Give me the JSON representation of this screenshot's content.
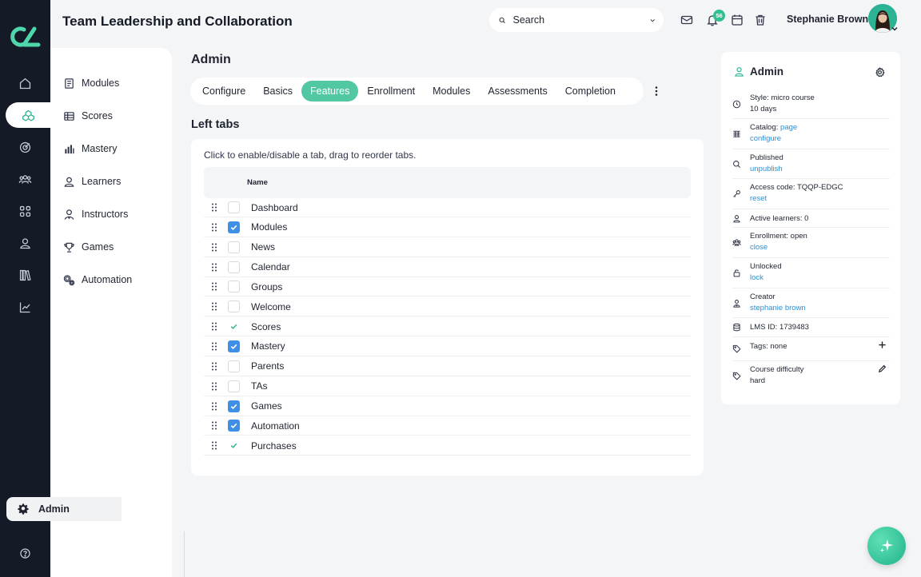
{
  "header": {
    "title": "Team Leadership and Collaboration",
    "search_placeholder": "Search",
    "notification_count": "56",
    "user_name": "Stephanie Brown"
  },
  "rail": {
    "icons": [
      "home-icon",
      "courses-icon",
      "target-icon",
      "groups-icon",
      "apps-icon",
      "person-icon",
      "library-icon",
      "analytics-icon",
      "help-icon"
    ]
  },
  "subnav": {
    "items": [
      {
        "label": "Modules",
        "icon": "modules-icon"
      },
      {
        "label": "Scores",
        "icon": "table-icon"
      },
      {
        "label": "Mastery",
        "icon": "bar-chart-icon"
      },
      {
        "label": "Learners",
        "icon": "learner-icon"
      },
      {
        "label": "Instructors",
        "icon": "instructor-icon"
      },
      {
        "label": "Games",
        "icon": "trophy-icon"
      },
      {
        "label": "Automation",
        "icon": "cogs-icon"
      }
    ],
    "bottom_label": "Admin"
  },
  "main": {
    "title": "Admin",
    "tabs": [
      {
        "label": "Configure",
        "active": false
      },
      {
        "label": "Basics",
        "active": false
      },
      {
        "label": "Features",
        "active": true
      },
      {
        "label": "Enrollment",
        "active": false
      },
      {
        "label": "Modules",
        "active": false
      },
      {
        "label": "Assessments",
        "active": false
      },
      {
        "label": "Completion",
        "active": false
      }
    ],
    "section_title": "Left tabs",
    "help_text": "Click to enable/disable a tab, drag to reorder tabs.",
    "column_name": "Name",
    "rows": [
      {
        "label": "Dashboard",
        "state": "unchecked"
      },
      {
        "label": "Modules",
        "state": "checked"
      },
      {
        "label": "News",
        "state": "unchecked"
      },
      {
        "label": "Calendar",
        "state": "unchecked"
      },
      {
        "label": "Groups",
        "state": "unchecked"
      },
      {
        "label": "Welcome",
        "state": "unchecked"
      },
      {
        "label": "Scores",
        "state": "tick"
      },
      {
        "label": "Mastery",
        "state": "checked"
      },
      {
        "label": "Parents",
        "state": "unchecked"
      },
      {
        "label": "TAs",
        "state": "unchecked"
      },
      {
        "label": "Games",
        "state": "checked"
      },
      {
        "label": "Automation",
        "state": "checked"
      },
      {
        "label": "Purchases",
        "state": "tick"
      }
    ]
  },
  "panel": {
    "title": "Admin",
    "rows": [
      {
        "icon": "clock-icon",
        "lines": [
          {
            "text": "Style: micro course"
          },
          {
            "text": "10 days"
          }
        ]
      },
      {
        "icon": "catalog-icon",
        "lines": [
          {
            "text": "Catalog: ",
            "link": "page"
          },
          {
            "link_only": "configure"
          }
        ]
      },
      {
        "icon": "search-icon",
        "lines": [
          {
            "text": "Published"
          },
          {
            "link_only": "unpublish"
          }
        ]
      },
      {
        "icon": "key-icon",
        "lines": [
          {
            "text": "Access code: TQQP-EDGC"
          },
          {
            "link_only": "reset"
          }
        ]
      },
      {
        "icon": "person-icon",
        "lines": [
          {
            "text": "Active learners: 0"
          }
        ]
      },
      {
        "icon": "group-icon",
        "lines": [
          {
            "text": "Enrollment: open"
          },
          {
            "link_only": "close"
          }
        ]
      },
      {
        "icon": "unlock-icon",
        "lines": [
          {
            "text": "Unlocked"
          },
          {
            "link_only": "lock"
          }
        ]
      },
      {
        "icon": "creator-icon",
        "lines": [
          {
            "text": "Creator"
          },
          {
            "link_only": "stephanie brown"
          }
        ]
      },
      {
        "icon": "database-icon",
        "lines": [
          {
            "text": "LMS ID: 1739483"
          }
        ]
      },
      {
        "icon": "tag-icon",
        "lines": [
          {
            "text": "Tags: none"
          }
        ],
        "action": "plus-icon"
      },
      {
        "icon": "tag-icon",
        "lines": [
          {
            "text": "Course difficulty"
          },
          {
            "text": "hard"
          }
        ],
        "action": "pencil-icon"
      }
    ]
  },
  "colors": {
    "rail_bg": "#141a26",
    "accent": "#2bb393",
    "active_tab": "#52c7a4",
    "checkbox": "#3f8fe6",
    "link": "#2a8fd4"
  }
}
